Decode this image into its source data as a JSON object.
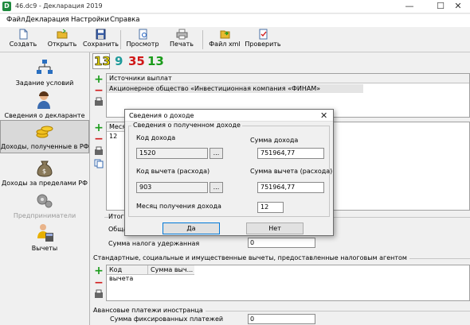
{
  "window": {
    "title": "46.dc9 - Декларация 2019",
    "app_icon": "D",
    "minimize": "—",
    "maximize": "☐",
    "close": "✕"
  },
  "menu": [
    "Файл",
    "Декларация",
    "Настройки",
    "Справка"
  ],
  "toolbar": {
    "create": "Создать",
    "open": "Открыть",
    "save": "Сохранить",
    "preview": "Просмотр",
    "print": "Печать",
    "xml": "Файл xml",
    "check": "Проверить"
  },
  "sidebar": {
    "items": [
      {
        "label": "Задание условий"
      },
      {
        "label": "Сведения о декларанте"
      },
      {
        "label": "Доходы, полученные в РФ"
      },
      {
        "label": "Доходы за пределами РФ"
      },
      {
        "label": "Предприниматели"
      },
      {
        "label": "Вычеты"
      }
    ]
  },
  "rates": [
    "13",
    "9",
    "35",
    "13"
  ],
  "rate_colors": [
    "#e8d800",
    "#1f9a9a",
    "#d01818",
    "#1a9b1a"
  ],
  "sources": {
    "header": "Источники выплат",
    "rows": [
      "Акционерное общество «Инвестиционная компания «ФИНАМ»"
    ]
  },
  "income_table": {
    "header": "Месяц",
    "rows": [
      "12"
    ]
  },
  "totals": {
    "legend": "Итоговые суммы",
    "total_label": "Общая сумма дохода",
    "tax_label": "Сумма налога удержанная",
    "tax_value": "0"
  },
  "deductions": {
    "legend": "Стандартные, социальные и имущественные вычеты, предоставленные налоговым агентом",
    "col1": "Код вычета",
    "col2": "Сумма выч..."
  },
  "advance": {
    "legend": "Авансовые платежи иностранца",
    "label": "Сумма фиксированных платежей",
    "value": "0"
  },
  "dialog": {
    "title": "Сведения о доходе",
    "close": "✕",
    "group": "Сведения о полученном доходе",
    "income_code_label": "Код дохода",
    "income_code": "1520",
    "income_sum_label": "Сумма дохода",
    "income_sum": "751964,77",
    "deduction_code_label": "Код вычета (расхода)",
    "deduction_code": "903",
    "deduction_sum_label": "Сумма вычета (расхода)",
    "deduction_sum": "751964,77",
    "month_label": "Месяц получения дохода",
    "month": "12",
    "dots": "...",
    "ok": "Да",
    "cancel": "Нет"
  }
}
